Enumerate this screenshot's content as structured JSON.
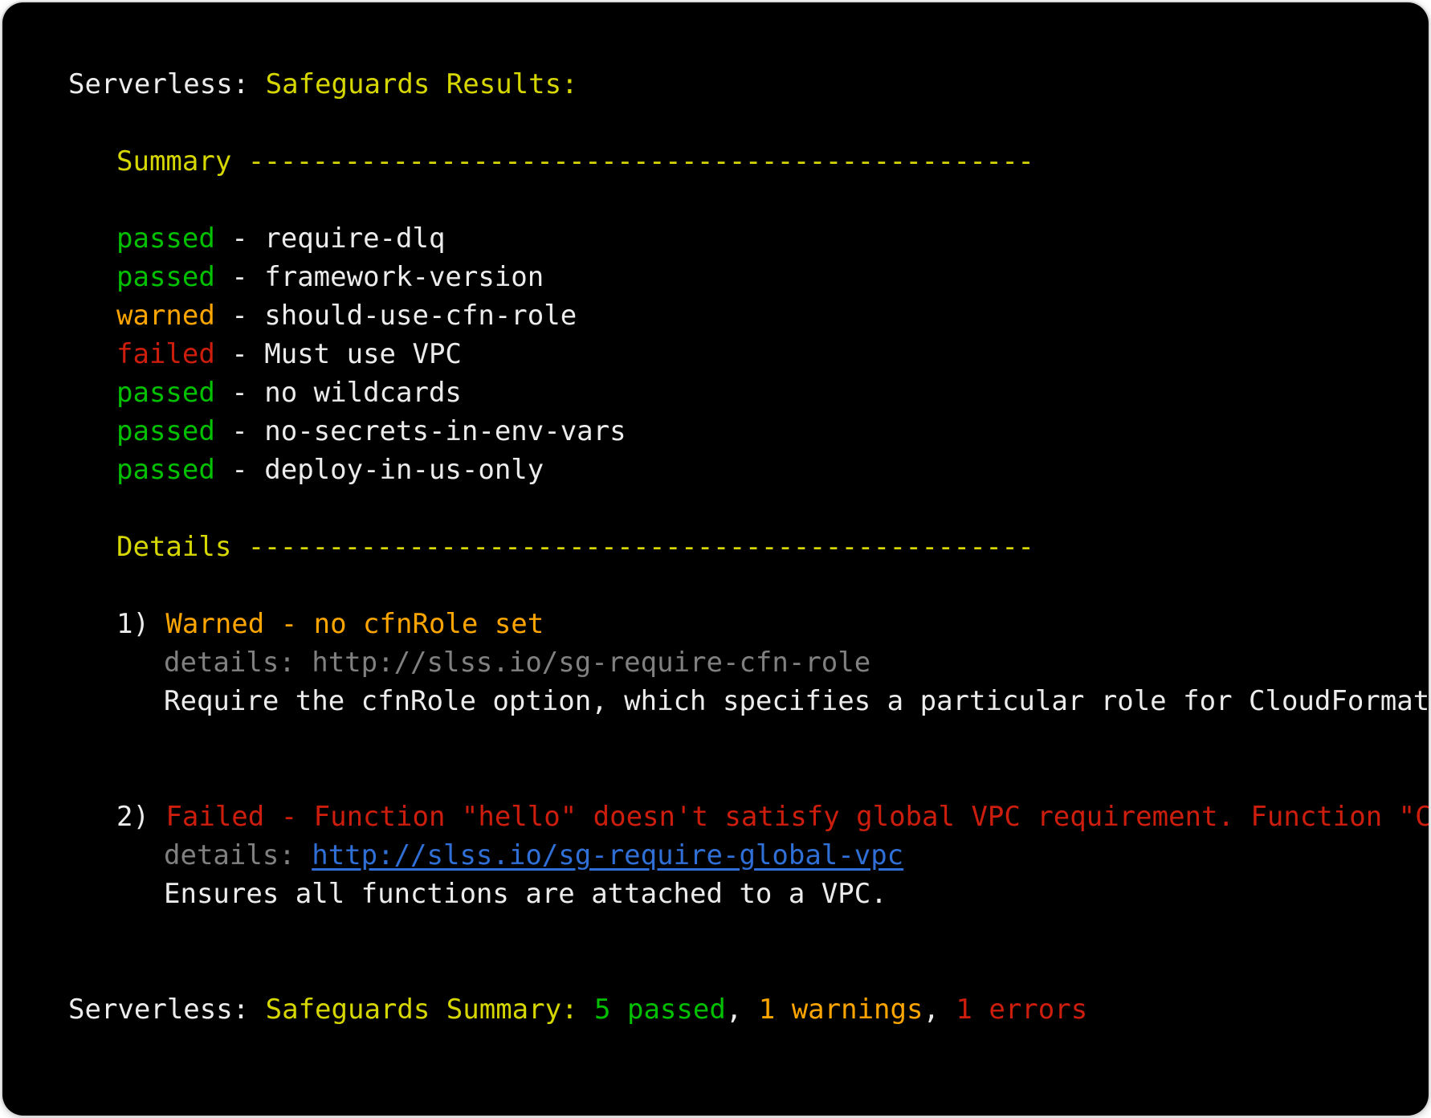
{
  "header": {
    "prefix": "Serverless: ",
    "title": "Safeguards Results:"
  },
  "summary": {
    "heading": "Summary",
    "rule": "-------------------------------------------------",
    "items": [
      {
        "status": "passed",
        "sep": " - ",
        "name": "require-dlq",
        "color": "#00c000"
      },
      {
        "status": "passed",
        "sep": " - ",
        "name": "framework-version",
        "color": "#00c000"
      },
      {
        "status": "warned",
        "sep": " - ",
        "name": "should-use-cfn-role",
        "color": "#ffa500"
      },
      {
        "status": "failed",
        "sep": " - ",
        "name": "Must use VPC",
        "color": "#cc1d0d"
      },
      {
        "status": "passed",
        "sep": " - ",
        "name": "no wildcards",
        "color": "#00c000"
      },
      {
        "status": "passed",
        "sep": " - ",
        "name": "no-secrets-in-env-vars",
        "color": "#00c000"
      },
      {
        "status": "passed",
        "sep": " - ",
        "name": "deploy-in-us-only",
        "color": "#00c000"
      }
    ]
  },
  "details": {
    "heading": "Details",
    "rule": "-------------------------------------------------",
    "entries": [
      {
        "number": "1) ",
        "title": "Warned - no cfnRole set",
        "title_color": "#ffa500",
        "details_label": "details: ",
        "details_url": "http://slss.io/sg-require-cfn-role",
        "description": "Require the cfnRole option, which specifies a particular role for CloudFormation"
      },
      {
        "number": "2) ",
        "title": "Failed - Function \"hello\" doesn't satisfy global VPC requirement. Function \"Cust",
        "title_color": "#cc1d0d",
        "details_label": "details: ",
        "details_url": "http://slss.io/sg-require-global-vpc",
        "description": "Ensures all functions are attached to a VPC."
      }
    ]
  },
  "footer": {
    "prefix": "Serverless: ",
    "label": "Safeguards Summary: ",
    "passed": "5 passed",
    "sep1": ", ",
    "warnings": "1 warnings",
    "sep2": ", ",
    "errors": "1 errors"
  },
  "colors": {
    "background": "#000000",
    "text": "#ececec",
    "yellow": "#d7d700",
    "green": "#00c000",
    "orange": "#ffa500",
    "red": "#cc1d0d",
    "gray": "#808080",
    "link": "#2f6fd6"
  }
}
